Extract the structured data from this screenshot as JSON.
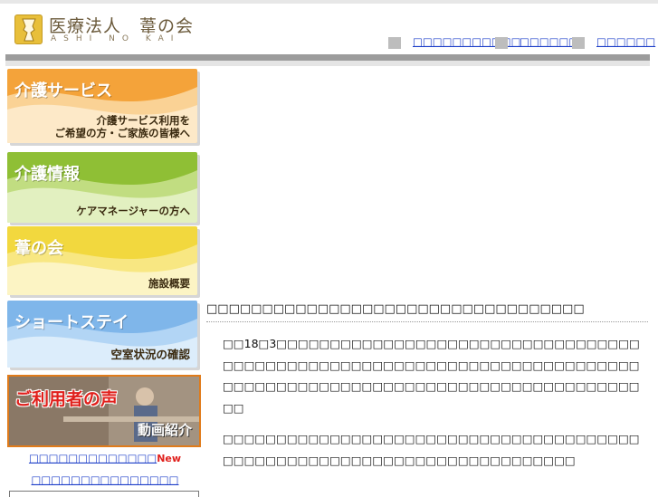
{
  "header": {
    "logo_title": "医療法人　葦の会",
    "logo_subtitle": "ASHI NO KAI",
    "nav": [
      {
        "label": "□□□□□□□□□□□"
      },
      {
        "label": "□□□□□□"
      },
      {
        "label": "□□□□□□"
      }
    ]
  },
  "sidebar": {
    "banners": [
      {
        "title": "介護サービス",
        "subtitle_line1": "介護サービス利用を",
        "subtitle_line2": "ご希望の方・ご家族の皆様へ"
      },
      {
        "title": "介護情報",
        "subtitle_line1": "ケアマネージャーの方へ",
        "subtitle_line2": ""
      },
      {
        "title": "葦の会",
        "subtitle_line1": "施設概要",
        "subtitle_line2": ""
      },
      {
        "title": "ショートステイ",
        "subtitle_line1": "空室状況の確認",
        "subtitle_line2": ""
      }
    ],
    "voice_banner": {
      "title": "ご利用者の声",
      "subtitle": "動画紹介"
    },
    "links": [
      {
        "label": "□□□□□□□□□□□□□",
        "badge": "New"
      },
      {
        "label": "□□□□□□□□□□□□□□□",
        "badge": ""
      }
    ]
  },
  "main": {
    "heading": "□□□□□□□□□□□□□□□□□□□□□□□□□□□□□□□□□□",
    "paragraphs": [
      "□□18□3□□□□□□□□□□□□□□□□□□□□□□□□□□□□□□□□□□□□□□□□□□□□□□□□□□□□□□□□□□□□□□□□□□□□□□□□□□□□□□□□□□□□□□□□□□□□□□□□□□□□□□□□□□□□□□□□□□",
      "□□□□□□□□□□□□□□□□□□□□□□□□□□□□□□□□□□□□□□□□□□□□□□□□□□□□□□□□□□□□□□□□□□□□□□□□"
    ]
  },
  "colors": {
    "link": "#1a3cc8",
    "banner_orange": "#f4a33a",
    "banner_green": "#8fbf35",
    "banner_yellow": "#f2d83e",
    "banner_blue": "#7fb6ea",
    "accent_red": "#e0201c"
  }
}
